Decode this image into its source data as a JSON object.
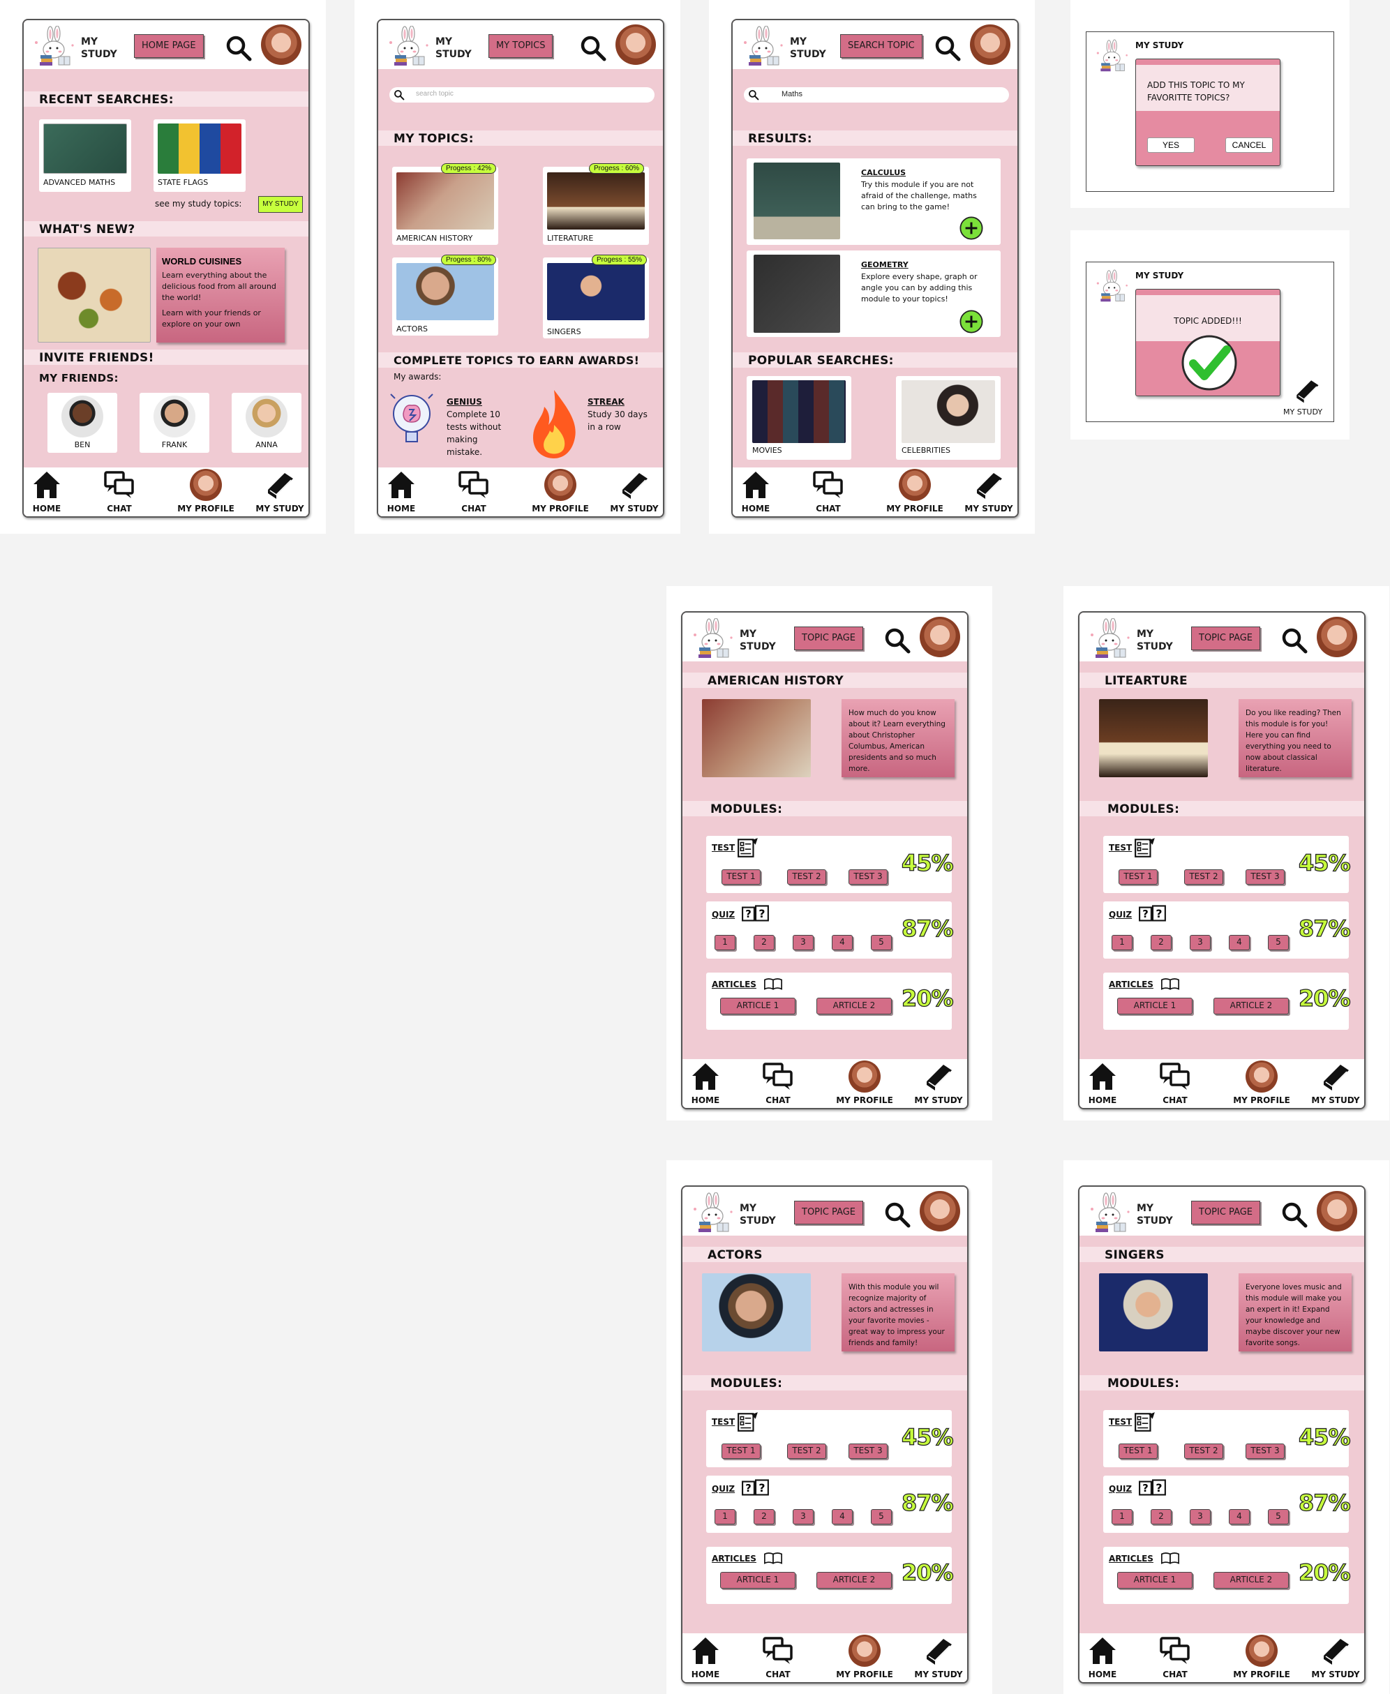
{
  "common": {
    "brand": "MY\nSTUDY",
    "brand_l1": "MY",
    "brand_l2": "STUDY",
    "nav": [
      "HOME",
      "CHAT",
      "MY PROFILE",
      "MY STUDY"
    ],
    "modules_title": "MODULES:",
    "test_label": "TEST",
    "quiz_label": "QUIZ",
    "articles_label": "ARTICLES",
    "tests": [
      "TEST 1",
      "TEST 2",
      "TEST 3"
    ],
    "quizzes": [
      "1",
      "2",
      "3",
      "4",
      "5"
    ],
    "articles": [
      "ARTICLE 1",
      "ARTICLE 2"
    ],
    "test_pct": "45%",
    "quiz_pct": "87%",
    "articles_pct": "20%",
    "topic_tag": "TOPIC PAGE"
  },
  "home": {
    "tag": "HOME PAGE",
    "recent_title": "RECENT SEARCHES:",
    "recent": [
      "ADVANCED MATHS",
      "STATE FLAGS"
    ],
    "see_topics": "see my study topics:",
    "my_study_btn": "MY STUDY",
    "whats_new": "WHAT'S NEW?",
    "news_title": "WORLD CUISINES",
    "news_body_1": "Learn everything about the delicious food from all around the world!",
    "news_body_2": "Learn with your friends or explore on your own",
    "invite": "INVITE FRIENDS!",
    "my_friends": "MY FRIENDS:",
    "friends": [
      "BEN",
      "FRANK",
      "ANNA"
    ]
  },
  "topics": {
    "tag": "MY TOPICS",
    "search_placeholder": "search topic",
    "title": "MY TOPICS:",
    "items": [
      {
        "name": "AMERICAN HISTORY",
        "progress": "Progess : 42%"
      },
      {
        "name": "LITERATURE",
        "progress": "Progess : 60%"
      },
      {
        "name": "ACTORS",
        "progress": "Progess : 80%"
      },
      {
        "name": "SINGERS",
        "progress": "Progess : 55%"
      }
    ],
    "awards_title": "COMPLETE TOPICS TO EARN AWARDS!",
    "my_awards": "My awards:",
    "genius_title": "GENIUS",
    "genius_body": "Complete 10 tests without making mistake.",
    "streak_title": "STREAK",
    "streak_body": "Study 30 days in a row"
  },
  "search": {
    "tag": "SEARCH TOPIC",
    "query": "Maths",
    "results_title": "RESULTS:",
    "results": [
      {
        "title": "CALCULUS",
        "body": "Try this module if you are not afraid of the challenge, maths can bring to the game!"
      },
      {
        "title": "GEOMETRY",
        "body": "Explore every shape, graph or angle you can by adding this module to your topics!"
      }
    ],
    "add_icon": "+",
    "popular_title": "POPULAR SEARCHES:",
    "popular": [
      "MOVIES",
      "CELEBRITIES"
    ]
  },
  "dialog1": {
    "brand": "MY STUDY",
    "question": "ADD THIS TOPIC TO MY FAVORITTE TOPICS?",
    "yes": "YES",
    "cancel": "CANCEL"
  },
  "dialog2": {
    "brand": "MY STUDY",
    "message": "TOPIC ADDED!!!",
    "nav_label": "MY STUDY"
  },
  "topic_pages": [
    {
      "title": "AMERICAN HISTORY",
      "desc": "How much do you know about it? Learn everything about Christopher Columbus, American presidents and so much more."
    },
    {
      "title": "LITEARTURE",
      "desc": "Do you like reading? Then this module is for you! Here you can find everything you need to now about classical literature."
    },
    {
      "title": "ACTORS",
      "desc": "With this module you wil recognize majority of actors and actresses in your favorite movies - great way to impress your friends and family!"
    },
    {
      "title": "SINGERS",
      "desc": "Everyone loves music and this module will make you an expert in it! Expand your knowledge and maybe discover your new favorite songs."
    }
  ],
  "colors": {
    "accent": "#d36d87",
    "bg_pink": "#f0cbd3",
    "lime": "#c7ff3d"
  }
}
